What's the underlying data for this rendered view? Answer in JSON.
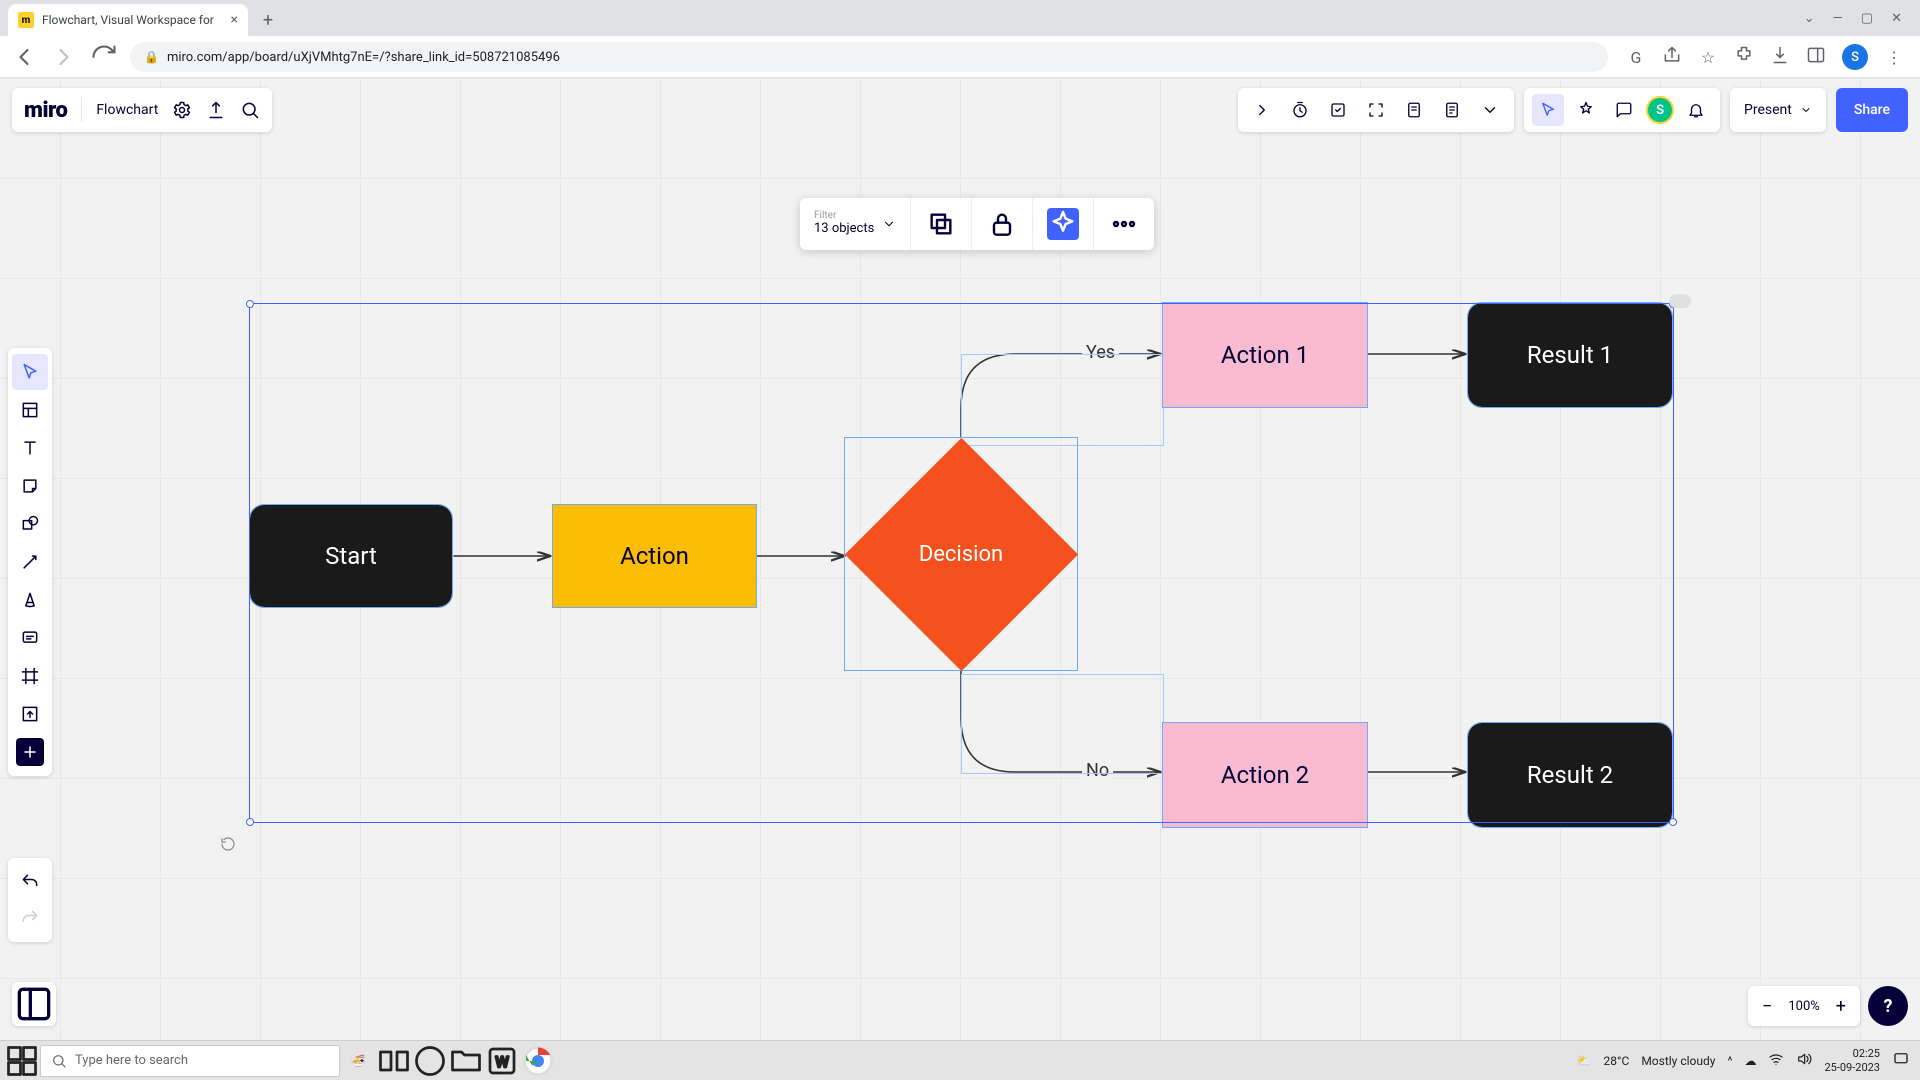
{
  "browser": {
    "tab_title": "Flowchart, Visual Workspace for",
    "url": "miro.com/app/board/uXjVMhtg7nE=/?share_link_id=508721085496",
    "avatar_letter": "S"
  },
  "board": {
    "logo": "miro",
    "name": "Flowchart"
  },
  "topbar": {
    "present": "Present",
    "share": "Share",
    "avatar_letter": "S"
  },
  "context_toolbar": {
    "filter_label": "Filter",
    "filter_value": "13 objects"
  },
  "zoom": {
    "level": "100%"
  },
  "flowchart": {
    "start": "Start",
    "action": "Action",
    "decision": "Decision",
    "action1": "Action 1",
    "action2": "Action 2",
    "result1": "Result 1",
    "result2": "Result 2",
    "yes": "Yes",
    "no": "No"
  },
  "taskbar": {
    "search_placeholder": "Type here to search",
    "weather_temp": "28°C",
    "weather_desc": "Mostly cloudy",
    "time": "02:25",
    "date": "25-09-2023"
  },
  "chart_data": {
    "type": "flowchart",
    "nodes": [
      {
        "id": "start",
        "type": "terminator",
        "label": "Start",
        "fill": "#1a1a1a",
        "text_color": "#ffffff"
      },
      {
        "id": "action",
        "type": "process",
        "label": "Action",
        "fill": "#fbbc04",
        "text_color": "#050038"
      },
      {
        "id": "decision",
        "type": "decision",
        "label": "Decision",
        "fill": "#f4511e",
        "text_color": "#ffffff"
      },
      {
        "id": "action1",
        "type": "process",
        "label": "Action 1",
        "fill": "#f8bbd0",
        "text_color": "#050038"
      },
      {
        "id": "action2",
        "type": "process",
        "label": "Action 2",
        "fill": "#f8bbd0",
        "text_color": "#050038"
      },
      {
        "id": "result1",
        "type": "terminator",
        "label": "Result 1",
        "fill": "#1a1a1a",
        "text_color": "#ffffff"
      },
      {
        "id": "result2",
        "type": "terminator",
        "label": "Result 2",
        "fill": "#1a1a1a",
        "text_color": "#ffffff"
      }
    ],
    "edges": [
      {
        "from": "start",
        "to": "action",
        "label": ""
      },
      {
        "from": "action",
        "to": "decision",
        "label": ""
      },
      {
        "from": "decision",
        "to": "action1",
        "label": "Yes"
      },
      {
        "from": "decision",
        "to": "action2",
        "label": "No"
      },
      {
        "from": "action1",
        "to": "result1",
        "label": ""
      },
      {
        "from": "action2",
        "to": "result2",
        "label": ""
      }
    ]
  }
}
